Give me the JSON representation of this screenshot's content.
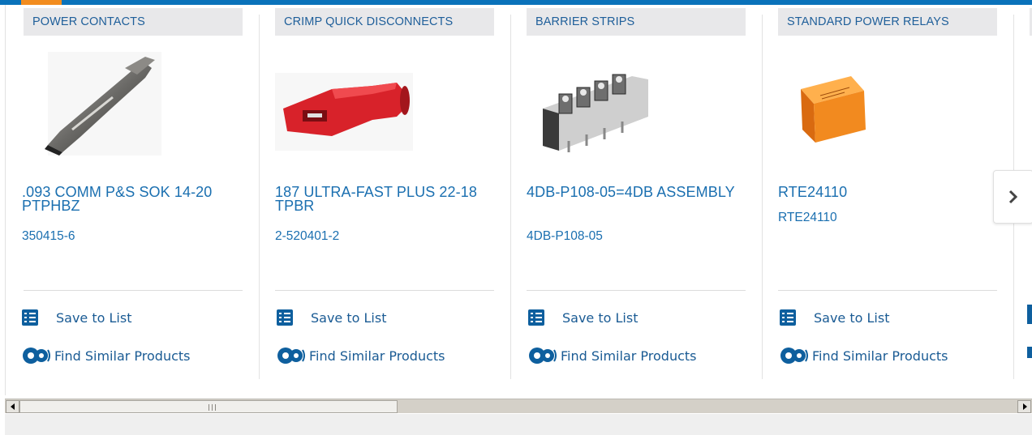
{
  "colors": {
    "brand_blue": "#0a72ba",
    "accent_orange": "#f28c1f",
    "link_blue": "#1a6fb0"
  },
  "products": [
    {
      "category": "POWER CONTACTS",
      "title": ".093 COMM P&S SOK 14-20 PTPHBZ",
      "part_number": "350415-6",
      "image": "power-contact"
    },
    {
      "category": "CRIMP QUICK DISCONNECTS",
      "title": "187 ULTRA-FAST PLUS 22-18 TPBR",
      "part_number": "2-520401-2",
      "image": "crimp-disconnect"
    },
    {
      "category": "BARRIER STRIPS",
      "title": "4DB-P108-05=4DB ASSEMBLY",
      "part_number": "4DB-P108-05",
      "image": "barrier-strip"
    },
    {
      "category": "STANDARD POWER RELAYS",
      "title": "RTE24110",
      "part_number": "RTE24110",
      "image": "power-relay"
    }
  ],
  "actions": {
    "save_label": "Save to List",
    "find_label": "Find Similar Products"
  },
  "icons": {
    "save": "checklist-icon",
    "find": "gears-icon",
    "next": "chevron-right-icon"
  }
}
